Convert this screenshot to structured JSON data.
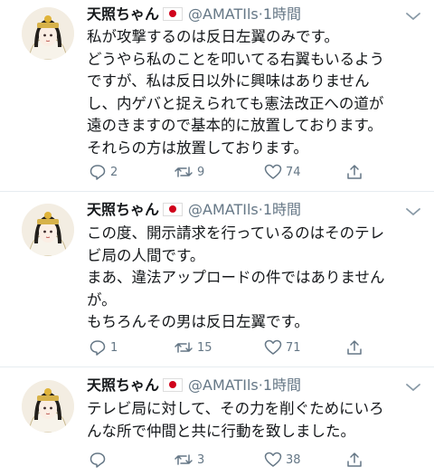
{
  "tweets": [
    {
      "name": "天照ちゃん",
      "handle": "@AMATIls",
      "time": "1時間",
      "lines": [
        "私が攻撃するのは反日左翼のみです。",
        "どうやら私のことを叩いてる右翼もいるよう",
        "ですが、私は反日以外に興味はありません",
        "し、内ゲバと捉えられても憲法改正への道が",
        "遠のきますので基本的に放置しております。",
        "それらの方は放置しております。"
      ],
      "replies": "2",
      "retweets": "9",
      "likes": "74"
    },
    {
      "name": "天照ちゃん",
      "handle": "@AMATIls",
      "time": "1時間",
      "lines": [
        "この度、開示請求を行っているのはそのテレ",
        "ビ局の人間です。",
        "まあ、違法アップロードの件ではありません",
        "が。",
        "もちろんその男は反日左翼です。"
      ],
      "replies": "1",
      "retweets": "15",
      "likes": "71"
    },
    {
      "name": "天照ちゃん",
      "handle": "@AMATIls",
      "time": "1時間",
      "lines": [
        "テレビ局に対して、その力を削ぐためにいろ",
        "んな所で仲間と共に行動を致しました。"
      ],
      "replies": "",
      "retweets": "3",
      "likes": "38"
    }
  ],
  "icons": {
    "reply": "speech-bubble-icon",
    "retweet": "retweet-arrows-icon",
    "like": "heart-icon",
    "share": "share-upload-icon",
    "more": "chevron-down-icon",
    "flag": "japan-flag-icon"
  },
  "colors": {
    "text": "#14171a",
    "muted": "#657786",
    "divider": "#e6ecf0",
    "flag_red": "#d0021b"
  }
}
